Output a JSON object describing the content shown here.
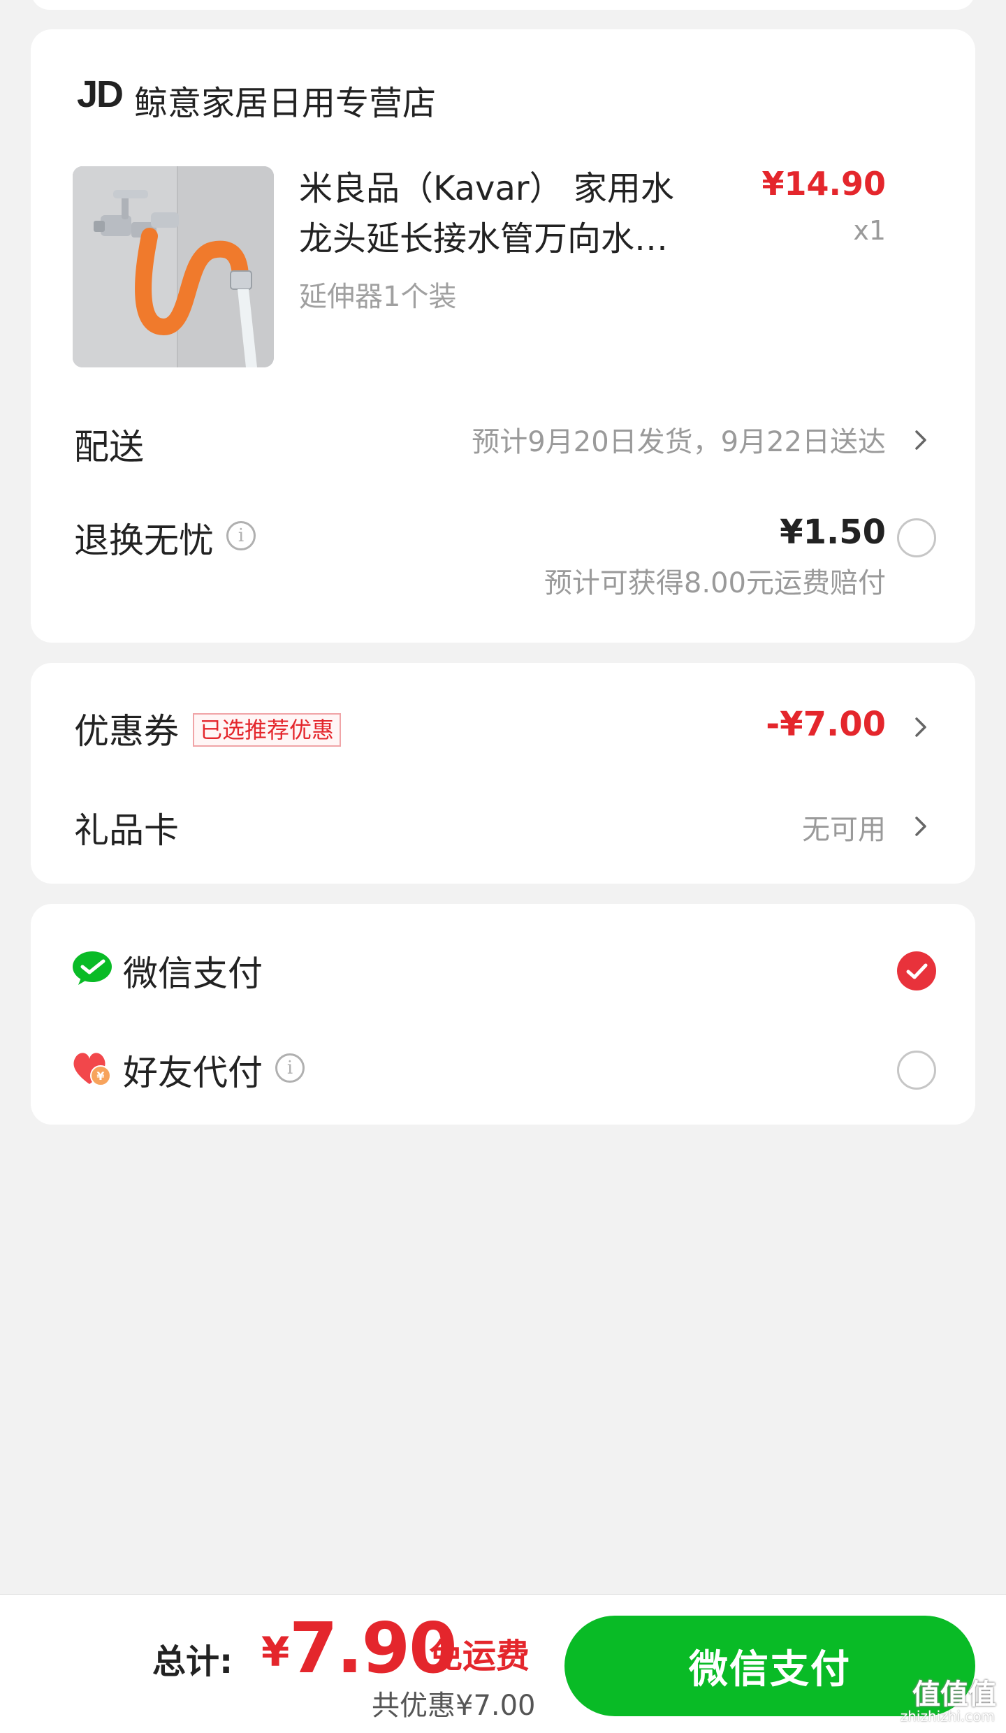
{
  "store": {
    "logo": "JD",
    "name": "鲸意家居日用专营店"
  },
  "product": {
    "title": "米良品（Kavar） 家用水龙头延长接水管万向水…",
    "spec": "延伸器1个装",
    "price": "¥14.90",
    "quantity": "x1",
    "image_icon": "faucet-extender-photo"
  },
  "delivery": {
    "label": "配送",
    "value": "预计9月20日发货，9月22日送达"
  },
  "return_worry_free": {
    "label": "退换无忧",
    "price": "¥1.50",
    "note": "预计可获得8.00元运费赔付",
    "selected": false
  },
  "coupon": {
    "label": "优惠券",
    "tag": "已选推荐优惠",
    "value": "-¥7.00"
  },
  "gift_card": {
    "label": "礼品卡",
    "value": "无可用"
  },
  "payment_methods": [
    {
      "label": "微信支付",
      "icon": "wechat-pay-icon",
      "selected": true
    },
    {
      "label": "好友代付",
      "icon": "friend-pay-heart-icon",
      "selected": false
    }
  ],
  "bottom_bar": {
    "total_label": "总计:",
    "currency": "¥",
    "total_amount": "7.90",
    "free_shipping": "免运费",
    "discount_summary": "共优惠¥7.00",
    "pay_button": "微信支付"
  },
  "watermark": {
    "main": "值值值",
    "sub": "zhizhizhi.com"
  },
  "colors": {
    "accent_red": "#e4262c",
    "pay_green": "#09bb26",
    "background": "#f2f2f2"
  }
}
